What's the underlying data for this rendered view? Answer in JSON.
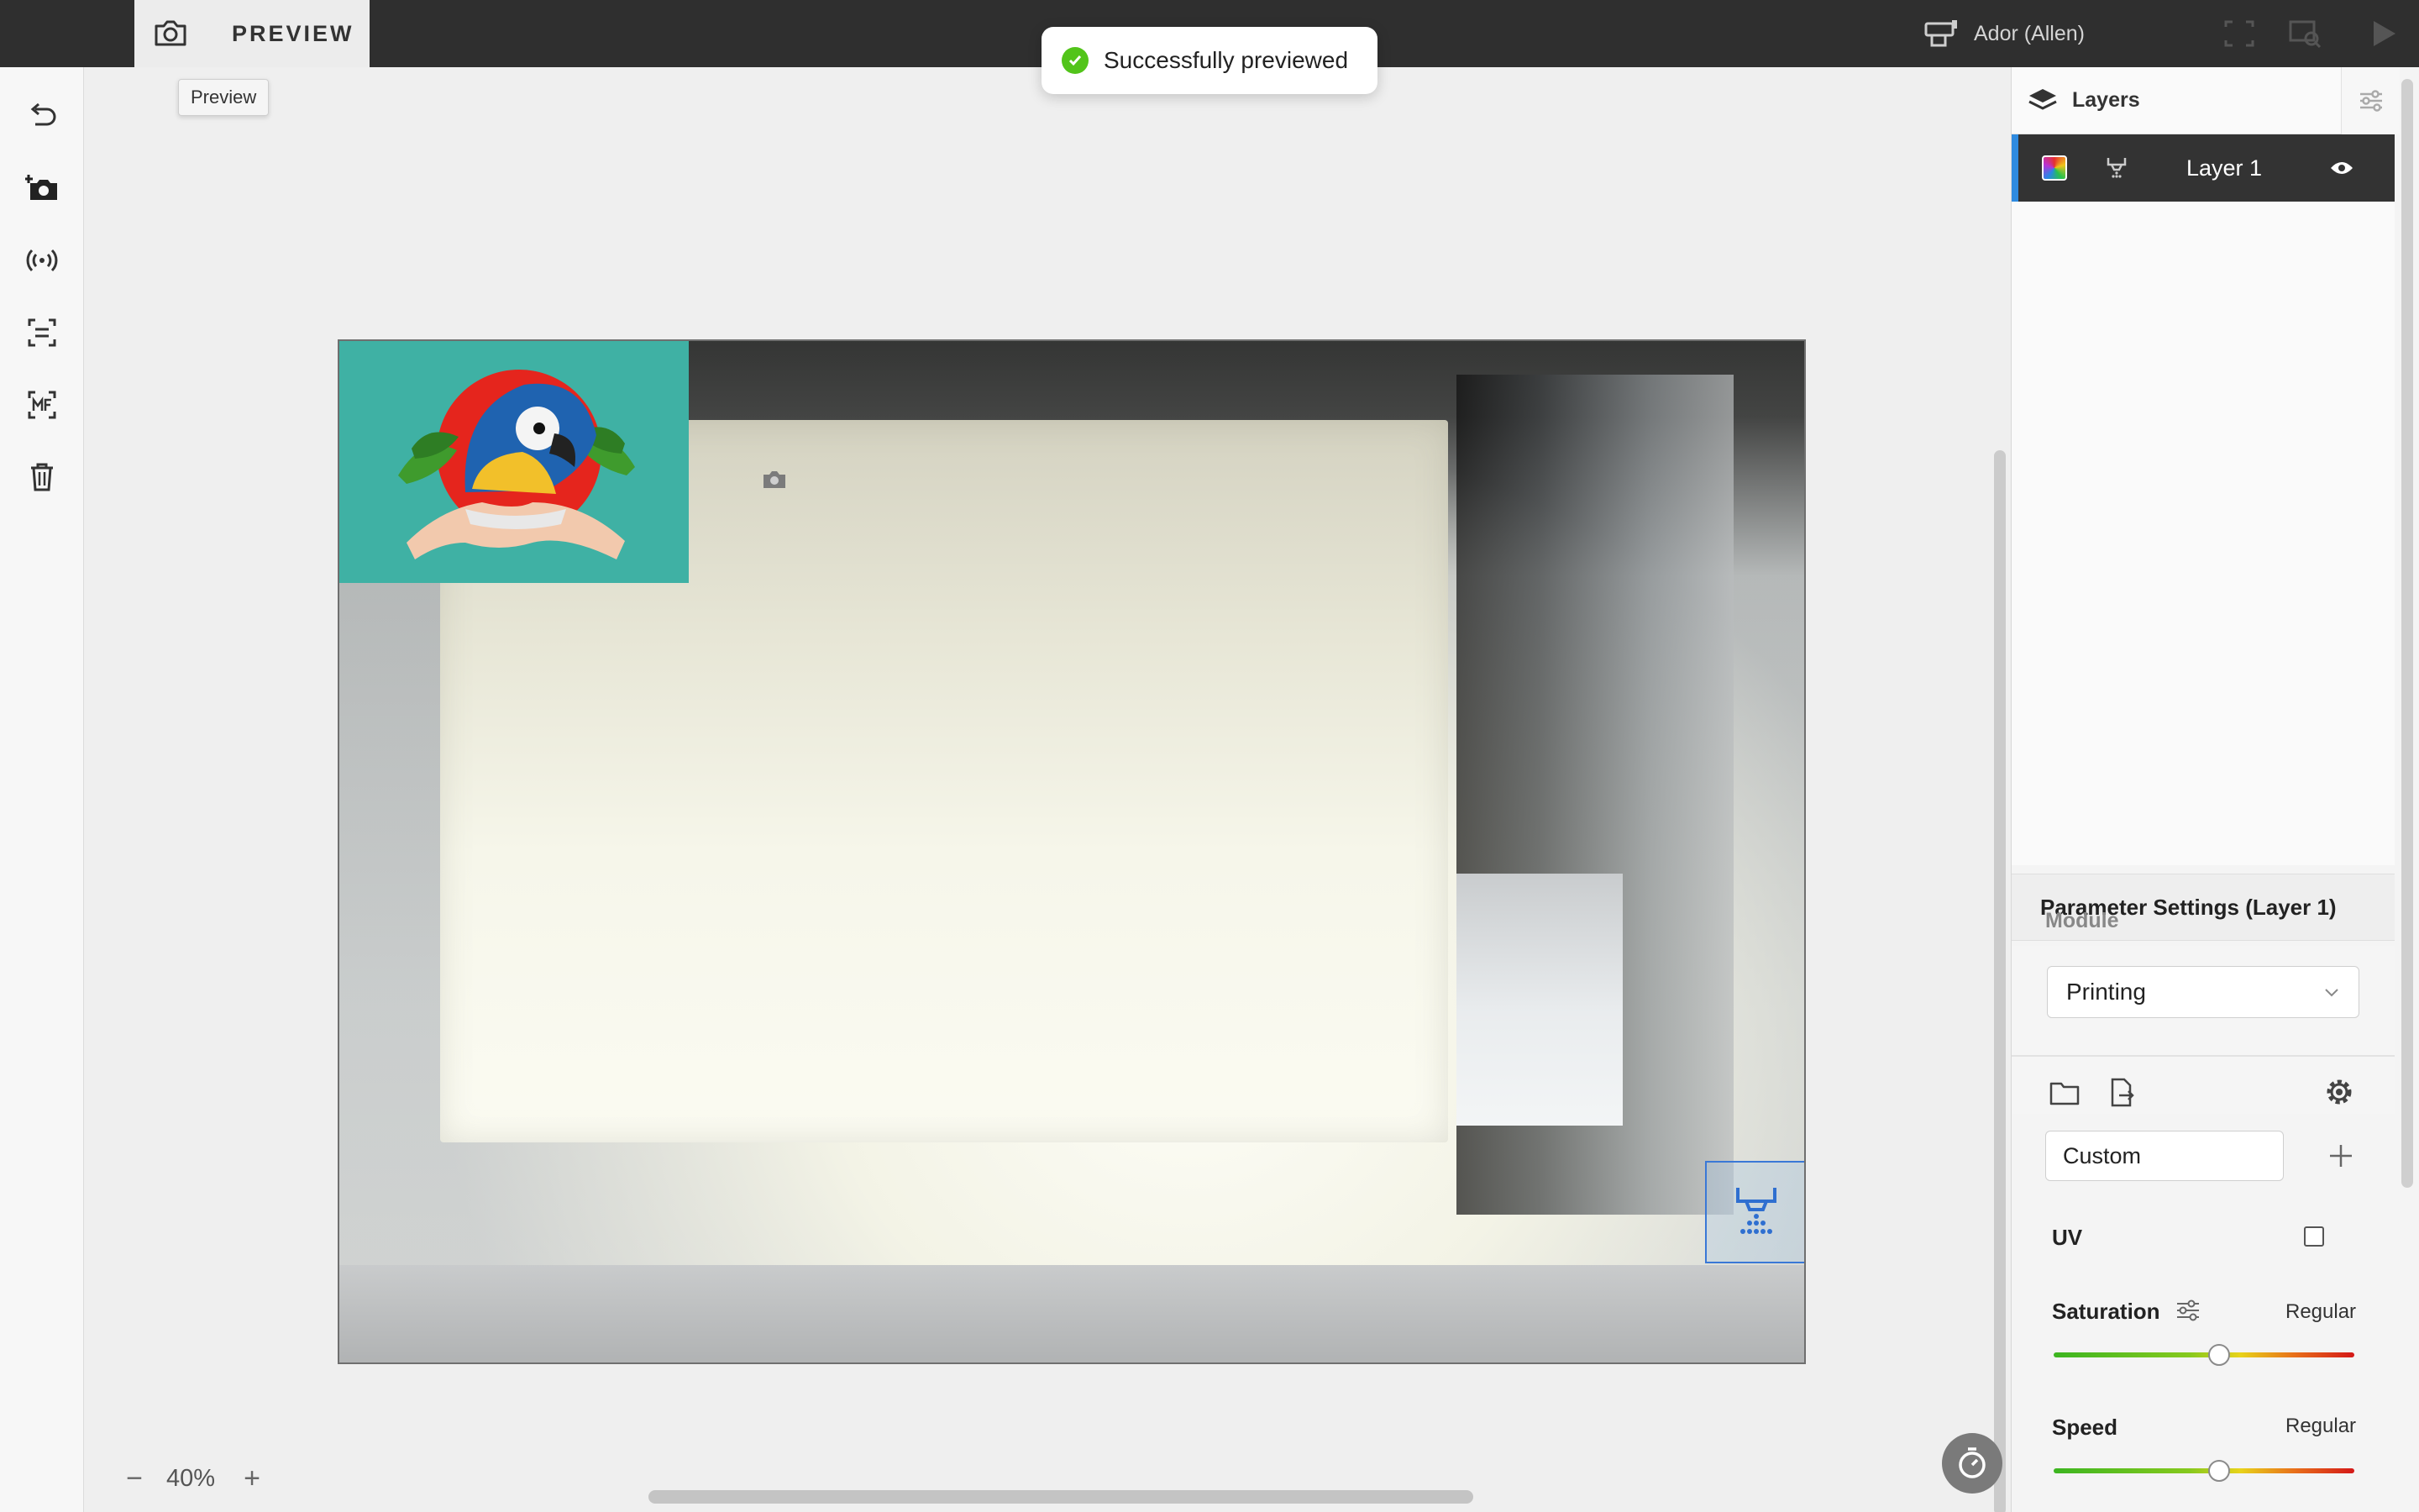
{
  "topbar": {
    "preview_label": "PREVIEW",
    "machine_name": "Ador (Allen)"
  },
  "tooltip": {
    "text": "Preview"
  },
  "toast": {
    "message": "Successfully previewed"
  },
  "left_toolbar": {
    "tools": [
      "undo-icon",
      "add-camera-icon",
      "connection-icon",
      "auto-focus-icon",
      "multi-focus-icon",
      "trash-icon"
    ]
  },
  "canvas": {
    "zoom": "40%",
    "zoom_out": "−",
    "zoom_in": "+"
  },
  "layers_panel": {
    "title": "Layers",
    "layers": [
      {
        "name": "Layer 1",
        "module": "printing",
        "visible": true
      }
    ],
    "add_label": "+"
  },
  "parameters": {
    "title": "Parameter Settings (Layer 1)",
    "module_label": "Module",
    "module_value": "Printing",
    "preset_value": "Custom",
    "uv_label": "UV",
    "uv_checked": false,
    "saturation": {
      "label": "Saturation",
      "value": "Regular",
      "position": 0.55
    },
    "speed": {
      "label": "Speed",
      "value": "Regular",
      "position": 0.55
    }
  },
  "colors": {
    "accent_blue": "#2f8be0",
    "success_green": "#52c41a",
    "image_teal": "#3fb1a4"
  }
}
